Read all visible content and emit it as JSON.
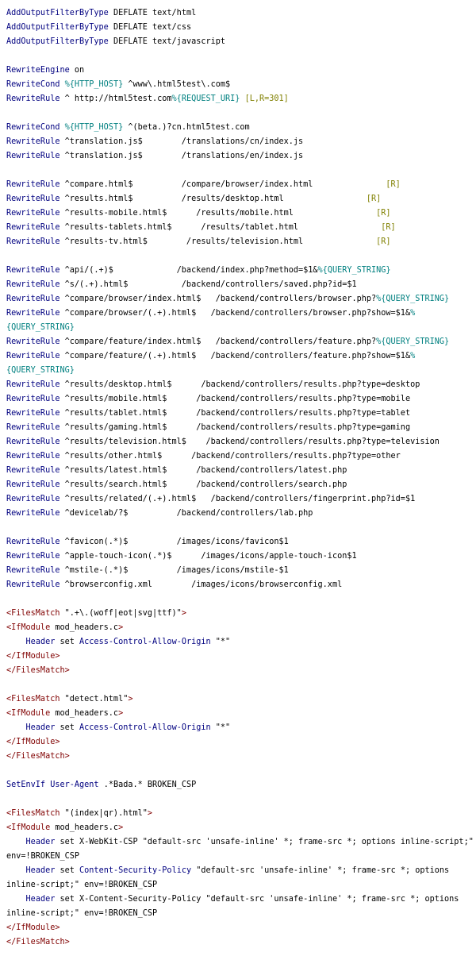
{
  "colors": {
    "background": "#ffffff",
    "directive": "#000080",
    "text": "#000000",
    "variable": "#008080",
    "flag": "#808000",
    "tag": "#800000",
    "string": "#000000"
  },
  "lines": [
    [
      {
        "t": "AddOutputFilterByType",
        "c": "directive"
      },
      {
        "t": " DEFLATE text/html"
      }
    ],
    [
      {
        "t": "AddOutputFilterByType",
        "c": "directive"
      },
      {
        "t": " DEFLATE text/css"
      }
    ],
    [
      {
        "t": "AddOutputFilterByType",
        "c": "directive"
      },
      {
        "t": " DEFLATE text/javascript"
      }
    ],
    [],
    [
      {
        "t": "RewriteEngine",
        "c": "directive"
      },
      {
        "t": " on"
      }
    ],
    [
      {
        "t": "RewriteCond",
        "c": "directive"
      },
      {
        "t": " "
      },
      {
        "t": "%{HTTP_HOST}",
        "c": "variable"
      },
      {
        "t": " ^www\\.html5test\\.com$"
      }
    ],
    [
      {
        "t": "RewriteRule",
        "c": "directive"
      },
      {
        "t": " ^ http://html5test.com"
      },
      {
        "t": "%{REQUEST_URI}",
        "c": "variable"
      },
      {
        "t": " "
      },
      {
        "t": "[L,R=301]",
        "c": "flag"
      }
    ],
    [],
    [
      {
        "t": "RewriteCond",
        "c": "directive"
      },
      {
        "t": " "
      },
      {
        "t": "%{HTTP_HOST}",
        "c": "variable"
      },
      {
        "t": " ^(beta.)?cn.html5test.com"
      }
    ],
    [
      {
        "t": "RewriteRule",
        "c": "directive"
      },
      {
        "t": " ^translation.js$        /translations/cn/index.js"
      }
    ],
    [
      {
        "t": "RewriteRule",
        "c": "directive"
      },
      {
        "t": " ^translation.js$        /translations/en/index.js"
      }
    ],
    [],
    [
      {
        "t": "RewriteRule",
        "c": "directive"
      },
      {
        "t": " ^compare.html$          /compare/browser/index.html               "
      },
      {
        "t": "[R]",
        "c": "flag"
      }
    ],
    [
      {
        "t": "RewriteRule",
        "c": "directive"
      },
      {
        "t": " ^results.html$          /results/desktop.html                 "
      },
      {
        "t": "[R]",
        "c": "flag"
      }
    ],
    [
      {
        "t": "RewriteRule",
        "c": "directive"
      },
      {
        "t": " ^results-mobile.html$      /results/mobile.html                 "
      },
      {
        "t": "[R]",
        "c": "flag"
      }
    ],
    [
      {
        "t": "RewriteRule",
        "c": "directive"
      },
      {
        "t": " ^results-tablets.html$      /results/tablet.html                 "
      },
      {
        "t": "[R]",
        "c": "flag"
      }
    ],
    [
      {
        "t": "RewriteRule",
        "c": "directive"
      },
      {
        "t": " ^results-tv.html$        /results/television.html               "
      },
      {
        "t": "[R]",
        "c": "flag"
      }
    ],
    [],
    [
      {
        "t": "RewriteRule",
        "c": "directive"
      },
      {
        "t": " ^api/(.+)$             /backend/index.php?method=$1&"
      },
      {
        "t": "%{QUERY_STRING}",
        "c": "variable"
      }
    ],
    [
      {
        "t": "RewriteRule",
        "c": "directive"
      },
      {
        "t": " ^s/(.+).html$           /backend/controllers/saved.php?id=$1"
      }
    ],
    [
      {
        "t": "RewriteRule",
        "c": "directive"
      },
      {
        "t": " ^compare/browser/index.html$   /backend/controllers/browser.php?"
      },
      {
        "t": "%{QUERY_STRING}",
        "c": "variable"
      }
    ],
    [
      {
        "t": "RewriteRule",
        "c": "directive"
      },
      {
        "t": " ^compare/browser/(.+).html$   /backend/controllers/browser.php?show=$1&"
      },
      {
        "t": "%",
        "c": "variable"
      }
    ],
    [
      {
        "t": "{QUERY_STRING}",
        "c": "variable"
      }
    ],
    [
      {
        "t": "RewriteRule",
        "c": "directive"
      },
      {
        "t": " ^compare/feature/index.html$   /backend/controllers/feature.php?"
      },
      {
        "t": "%{QUERY_STRING}",
        "c": "variable"
      }
    ],
    [
      {
        "t": "RewriteRule",
        "c": "directive"
      },
      {
        "t": " ^compare/feature/(.+).html$   /backend/controllers/feature.php?show=$1&"
      },
      {
        "t": "%",
        "c": "variable"
      }
    ],
    [
      {
        "t": "{QUERY_STRING}",
        "c": "variable"
      }
    ],
    [
      {
        "t": "RewriteRule",
        "c": "directive"
      },
      {
        "t": " ^results/desktop.html$      /backend/controllers/results.php?type=desktop"
      }
    ],
    [
      {
        "t": "RewriteRule",
        "c": "directive"
      },
      {
        "t": " ^results/mobile.html$      /backend/controllers/results.php?type=mobile"
      }
    ],
    [
      {
        "t": "RewriteRule",
        "c": "directive"
      },
      {
        "t": " ^results/tablet.html$      /backend/controllers/results.php?type=tablet"
      }
    ],
    [
      {
        "t": "RewriteRule",
        "c": "directive"
      },
      {
        "t": " ^results/gaming.html$      /backend/controllers/results.php?type=gaming"
      }
    ],
    [
      {
        "t": "RewriteRule",
        "c": "directive"
      },
      {
        "t": " ^results/television.html$    /backend/controllers/results.php?type=television"
      }
    ],
    [
      {
        "t": "RewriteRule",
        "c": "directive"
      },
      {
        "t": " ^results/other.html$      /backend/controllers/results.php?type=other"
      }
    ],
    [
      {
        "t": "RewriteRule",
        "c": "directive"
      },
      {
        "t": " ^results/latest.html$      /backend/controllers/latest.php"
      }
    ],
    [
      {
        "t": "RewriteRule",
        "c": "directive"
      },
      {
        "t": " ^results/search.html$      /backend/controllers/search.php"
      }
    ],
    [
      {
        "t": "RewriteRule",
        "c": "directive"
      },
      {
        "t": " ^results/related/(.+).html$   /backend/controllers/fingerprint.php?id=$1"
      }
    ],
    [
      {
        "t": "RewriteRule",
        "c": "directive"
      },
      {
        "t": " ^devicelab/?$          /backend/controllers/lab.php"
      }
    ],
    [],
    [
      {
        "t": "RewriteRule",
        "c": "directive"
      },
      {
        "t": " ^favicon(.*)$          /images/icons/favicon$1"
      }
    ],
    [
      {
        "t": "RewriteRule",
        "c": "directive"
      },
      {
        "t": " ^apple-touch-icon(.*)$      /images/icons/apple-touch-icon$1"
      }
    ],
    [
      {
        "t": "RewriteRule",
        "c": "directive"
      },
      {
        "t": " ^mstile-(.*)$          /images/icons/mstile-$1"
      }
    ],
    [
      {
        "t": "RewriteRule",
        "c": "directive"
      },
      {
        "t": " ^browserconfig.xml        /images/icons/browserconfig.xml"
      }
    ],
    [],
    [
      {
        "t": "<FilesMatch",
        "c": "tag"
      },
      {
        "t": " \".+\\.(woff|eot|svg|ttf)\""
      },
      {
        "t": ">",
        "c": "tag"
      }
    ],
    [
      {
        "t": "<IfModule",
        "c": "tag"
      },
      {
        "t": " mod_headers.c"
      },
      {
        "t": ">",
        "c": "tag"
      }
    ],
    [
      {
        "t": "    "
      },
      {
        "t": "Header",
        "c": "directive"
      },
      {
        "t": " set "
      },
      {
        "t": "Access-Control-Allow-Origin",
        "c": "directive"
      },
      {
        "t": " \"*\""
      }
    ],
    [
      {
        "t": "</IfModule>",
        "c": "tag"
      }
    ],
    [
      {
        "t": "</FilesMatch>",
        "c": "tag"
      }
    ],
    [],
    [
      {
        "t": "<FilesMatch",
        "c": "tag"
      },
      {
        "t": " \"detect.html\""
      },
      {
        "t": ">",
        "c": "tag"
      }
    ],
    [
      {
        "t": "<IfModule",
        "c": "tag"
      },
      {
        "t": " mod_headers.c"
      },
      {
        "t": ">",
        "c": "tag"
      }
    ],
    [
      {
        "t": "    "
      },
      {
        "t": "Header",
        "c": "directive"
      },
      {
        "t": " set "
      },
      {
        "t": "Access-Control-Allow-Origin",
        "c": "directive"
      },
      {
        "t": " \"*\""
      }
    ],
    [
      {
        "t": "</IfModule>",
        "c": "tag"
      }
    ],
    [
      {
        "t": "</FilesMatch>",
        "c": "tag"
      }
    ],
    [],
    [
      {
        "t": "SetEnvIf",
        "c": "directive"
      },
      {
        "t": " "
      },
      {
        "t": "User-Agent",
        "c": "directive"
      },
      {
        "t": " .*Bada.* BROKEN_CSP"
      }
    ],
    [],
    [
      {
        "t": "<FilesMatch",
        "c": "tag"
      },
      {
        "t": " \"(index|qr).html\""
      },
      {
        "t": ">",
        "c": "tag"
      }
    ],
    [
      {
        "t": "<IfModule",
        "c": "tag"
      },
      {
        "t": " mod_headers.c"
      },
      {
        "t": ">",
        "c": "tag"
      }
    ],
    [
      {
        "t": "    "
      },
      {
        "t": "Header",
        "c": "directive"
      },
      {
        "t": " set X-WebKit-CSP \"default-src 'unsafe-inline' *; frame-src *; options inline-script;\""
      }
    ],
    [
      {
        "t": "env=!BROKEN_CSP"
      }
    ],
    [
      {
        "t": "    "
      },
      {
        "t": "Header",
        "c": "directive"
      },
      {
        "t": " set "
      },
      {
        "t": "Content-Security-Policy",
        "c": "directive"
      },
      {
        "t": " \"default-src 'unsafe-inline' *; frame-src *; options"
      }
    ],
    [
      {
        "t": "inline-script;\" env=!BROKEN_CSP"
      }
    ],
    [
      {
        "t": "    "
      },
      {
        "t": "Header",
        "c": "directive"
      },
      {
        "t": " set X-Content-Security-Policy \"default-src 'unsafe-inline' *; frame-src *; options"
      }
    ],
    [
      {
        "t": "inline-script;\" env=!BROKEN_CSP"
      }
    ],
    [
      {
        "t": "</IfModule>",
        "c": "tag"
      }
    ],
    [
      {
        "t": "</FilesMatch>",
        "c": "tag"
      }
    ]
  ]
}
